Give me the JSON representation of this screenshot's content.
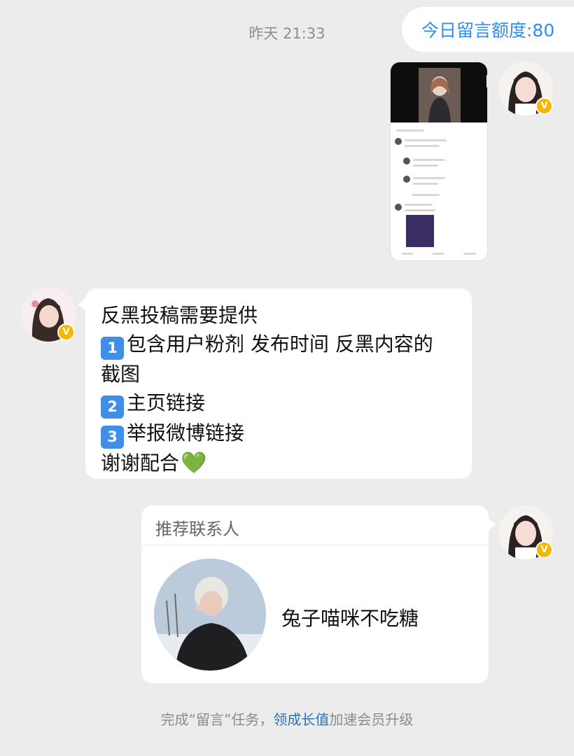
{
  "header": {
    "timestamp": "昨天 21:33",
    "quota_label": "今日留言额度:80"
  },
  "messages": {
    "sender_avatar_icon": "user-avatar-girl",
    "verified_icon": "verified-v-badge",
    "verified_mark": "V",
    "screenshot_alt": "comment screenshot image",
    "text_message": {
      "lines": [
        {
          "text": "反黑投稿需要提供",
          "badge": ""
        },
        {
          "badge": "1",
          "text": "包含用户粉剂 发布时间 反黑内容的"
        },
        {
          "text": "截图",
          "badge": ""
        },
        {
          "badge": "2",
          "text": "主页链接"
        },
        {
          "badge": "3",
          "text": "举报微博链接"
        },
        {
          "text": "谢谢配合",
          "badge": "",
          "emoji": "💚"
        }
      ]
    }
  },
  "contact_card": {
    "title": "推荐联系人",
    "name": "兔子喵咪不吃糖"
  },
  "footer": {
    "prefix": "完成“留言”任务，",
    "link": "领成长值",
    "suffix": "加速会员升级"
  }
}
